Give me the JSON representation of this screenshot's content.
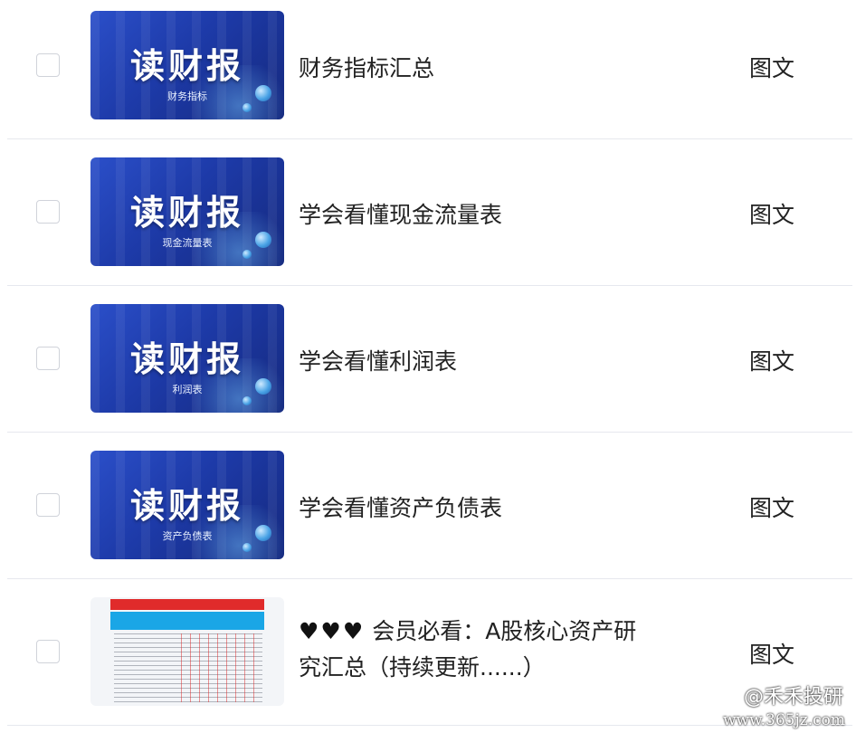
{
  "items": [
    {
      "title": "财务指标汇总",
      "type": "图文",
      "thumb_main": "读财报",
      "thumb_sub": "财务指标"
    },
    {
      "title": "学会看懂现金流量表",
      "type": "图文",
      "thumb_main": "读财报",
      "thumb_sub": "现金流量表"
    },
    {
      "title": "学会看懂利润表",
      "type": "图文",
      "thumb_main": "读财报",
      "thumb_sub": "利润表"
    },
    {
      "title": "学会看懂资产负债表",
      "type": "图文",
      "thumb_main": "读财报",
      "thumb_sub": "资产负债表"
    },
    {
      "hearts": "♥♥♥",
      "title_line1": "会员必看：A股核心资产研",
      "title_line2": "究汇总（持续更新......）",
      "type": "图文"
    }
  ],
  "watermark": {
    "name": "@禾禾投研",
    "site": "www.365jz.com"
  },
  "colors": {
    "thumb_blue": "#1d3aa8",
    "divider": "#e6e8ee"
  }
}
